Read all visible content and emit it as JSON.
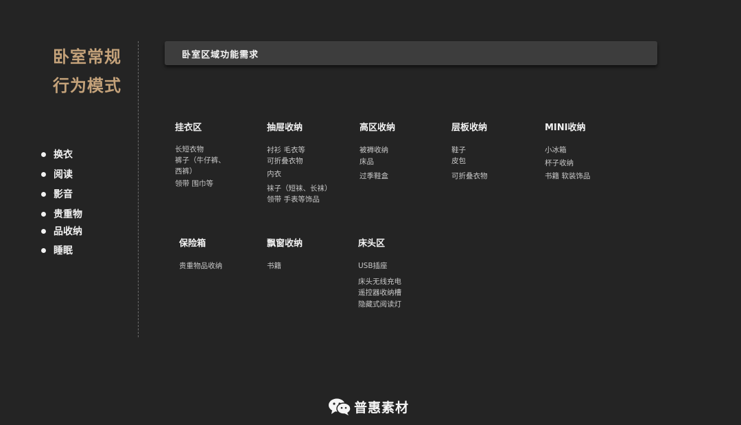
{
  "title": {
    "line1": "卧室常规",
    "line2": "行为模式"
  },
  "behaviors": [
    "换衣",
    "阅读",
    "影音",
    "贵重物",
    "品收纳",
    "睡眠"
  ],
  "header": {
    "label": "卧室区域功能需求"
  },
  "categories": [
    {
      "title": "挂衣区",
      "items": [
        "长短衣物",
        "裤子（牛仔裤、",
        "西裤）",
        "领带 围巾等"
      ]
    },
    {
      "title": "抽屉收纳",
      "items": [
        "衬衫 毛衣等",
        "可折叠衣物",
        "内衣",
        "袜子（短袜、长袜）",
        "领带 手表等饰品"
      ]
    },
    {
      "title": "高区收纳",
      "items": [
        "被褥收纳",
        "床品",
        "过季鞋盒"
      ]
    },
    {
      "title": "层板收纳",
      "items": [
        "鞋子",
        "皮包",
        "可折叠衣物"
      ]
    },
    {
      "title": "MINI收纳",
      "items": [
        "小冰箱",
        "杯子收纳",
        "书籍 软装饰品"
      ]
    },
    {
      "title": "保险箱",
      "items": [
        "贵重物品收纳"
      ]
    },
    {
      "title": "飘窗收纳",
      "items": [
        "书籍"
      ]
    },
    {
      "title": "床头区",
      "items": [
        "USB插座",
        "床头无线充电",
        "遥控器收纳槽",
        "隐藏式阅读灯"
      ]
    }
  ],
  "footer": {
    "brand": "普惠素材",
    "icon": "wechat-icon"
  }
}
